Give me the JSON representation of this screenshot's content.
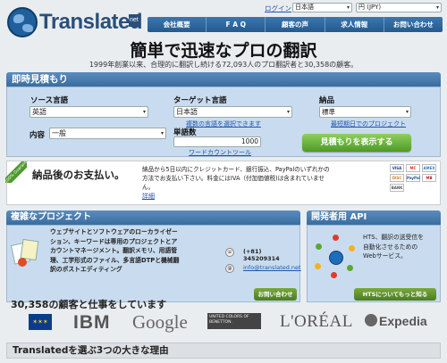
{
  "header": {
    "logo_text": "Translated",
    "logo_suffix": "net",
    "login_label": "ログイン",
    "language_select": "日本語",
    "currency_select": "円 (JPY)"
  },
  "nav": {
    "items": [
      {
        "label": "会社概要"
      },
      {
        "label": "F A Q"
      },
      {
        "label": "顧客の声"
      },
      {
        "label": "求人情報"
      },
      {
        "label": "お問い合わせ"
      }
    ]
  },
  "hero": {
    "headline": "簡単で迅速なプロの翻訳",
    "subline": "1999年創業以来、合理的に翻訳し続ける72,093人のプロ翻訳者と30,358の顧客。"
  },
  "quote": {
    "title": "即時見積もり",
    "source_label": "ソース言語",
    "source_value": "英語",
    "target_label": "ターゲット言語",
    "target_value": "日本語",
    "multi_target_link": "複数の言語を選択できます",
    "delivery_label": "納品",
    "delivery_value": "標準",
    "earliest_link": "最短期日でのプロジェクト",
    "content_label": "内容",
    "content_value": "一般",
    "words_label": "単語数",
    "words_value": "1000",
    "word_count_link": "ワードカウントツール",
    "submit_button": "見積もりを表示する"
  },
  "payment": {
    "ribbon": "100% Guarantee",
    "title": "納品後のお支払い。",
    "text_line1": "納品から5日以内にクレジットカード、銀行振込、PayPalのいずれかの",
    "text_line2": "方法でお支払い下さい。料金にはIVA（付加価値税)は含まれていませ",
    "text_line3": "ん。",
    "details_link": "詳細",
    "cards": [
      {
        "name": "VISA",
        "color": "#1a3f8f"
      },
      {
        "name": "MC",
        "color": "#e0312b"
      },
      {
        "name": "AMEX",
        "color": "#2f7fc1"
      },
      {
        "name": "DISC",
        "color": "#e67817"
      },
      {
        "name": "PayPal",
        "color": "#1e4f9a"
      },
      {
        "name": "MB",
        "color": "#b5262a"
      },
      {
        "name": "BANK",
        "color": "#555555"
      }
    ]
  },
  "complex": {
    "title": "複雑なプロジェクト",
    "text_line1": "ウェブサイトとソフトウェアのローカライゼー",
    "text_line2": "ション、キーワードは専用のプロジェクトとア",
    "text_line3": "カウントマネージメント。翻訳メモリ、用語管",
    "text_line4": "理、工学形式のファイル、多言語DTPと機械翻",
    "text_line5": "訳のポストエディティング",
    "phone": "(+81) 345209314",
    "email": "info@translated.net",
    "contact_button": "お問い合わせ"
  },
  "developer": {
    "title": "開発者用 API",
    "text_line1": "HTS、翻訳の送受信を",
    "text_line2": "自動化させるための",
    "text_line3": "Webサービス。",
    "more_button": "HTSについてもっと知る"
  },
  "clients": {
    "title": "30,358の顧客と仕事をしています",
    "logos": [
      "IBM",
      "Google",
      "UNITED COLORS OF BENETTON.",
      "L'ORÉAL",
      "Expedia"
    ]
  },
  "reasons": {
    "title": "Translatedを選ぶ3つの大きな理由"
  },
  "colors": {
    "nav_blue": "#245a8e",
    "panel_blue": "#c9dcef",
    "button_green": "#4d9a24"
  }
}
